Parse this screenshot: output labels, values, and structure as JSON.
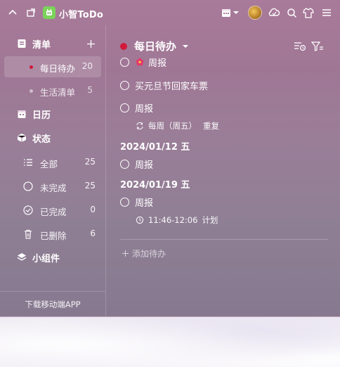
{
  "app": {
    "title": "小智ToDo"
  },
  "sidebar": {
    "lists_header": "清单",
    "lists": [
      {
        "label": "每日待办",
        "count": "20"
      },
      {
        "label": "生活清单",
        "count": "5"
      }
    ],
    "calendar_label": "日历",
    "status_header": "状态",
    "status_items": [
      {
        "label": "全部",
        "count": "25"
      },
      {
        "label": "未完成",
        "count": "25"
      },
      {
        "label": "已完成",
        "count": "0"
      },
      {
        "label": "已删除",
        "count": "6"
      }
    ],
    "widgets_label": "小组件",
    "download_label": "下载移动端APP"
  },
  "main": {
    "list_title": "每日待办",
    "tasks_top": [
      {
        "title": "周报"
      },
      {
        "title": "买元旦节回家车票"
      },
      {
        "title": "周报",
        "repeat": "每周（周五）",
        "repeat_label": "重复"
      }
    ],
    "groups": [
      {
        "date": "2024/01/12 五",
        "tasks": [
          {
            "title": "周报"
          }
        ]
      },
      {
        "date": "2024/01/19 五",
        "tasks": [
          {
            "title": "周报",
            "time": "11:46-12:06",
            "time_label": "计划"
          }
        ]
      }
    ],
    "add_placeholder": "添加待办"
  },
  "colors": {
    "accent_red": "#d1193a",
    "logo_green": "#7bd35a"
  }
}
